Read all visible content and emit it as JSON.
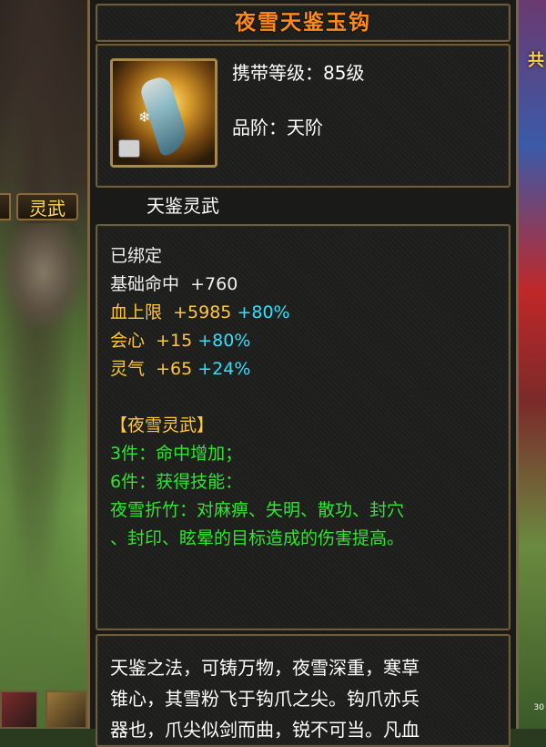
{
  "item": {
    "name": "夜雪天鉴玉钩",
    "carry_level": "携带等级：85级",
    "grade": "品阶：天阶",
    "type": "天鉴灵武",
    "icon": "jade-hook-weapon-icon"
  },
  "attributes": {
    "bound": "已绑定",
    "stats": [
      {
        "name": "基础命中",
        "value": "+760",
        "bonus": ""
      },
      {
        "name": "血上限",
        "value": "+5985",
        "bonus": "+80%"
      },
      {
        "name": "会心",
        "value": "+15",
        "bonus": "+80%"
      },
      {
        "name": "灵气",
        "value": "+65",
        "bonus": "+24%"
      }
    ],
    "set_name": "【夜雪灵武】",
    "set_bonus_3": "3件：命中增加；",
    "set_bonus_6": "6件：获得技能：",
    "skill_line1": "夜雪折竹：对麻痹、失明、散功、封穴",
    "skill_line2": "、封印、眩晕的目标造成的伤害提高。"
  },
  "description": {
    "line1": "天鉴之法，可铸万物，夜雪深重，寒草",
    "line2": "锥心，其雪粉飞于钩爪之尖。钩爪亦兵",
    "line3": "器也，爪尖似剑而曲，锐不可当。凡血"
  },
  "scene": {
    "tab_label": "灵武",
    "right_label": "共",
    "right_bottom": "30"
  },
  "colors": {
    "title": "#ff8a1a",
    "stat_gold": "#ffc83a",
    "bonus_cyan": "#33e0ff",
    "set_green": "#2ee62e",
    "frame_border": "#6e5d3c"
  }
}
